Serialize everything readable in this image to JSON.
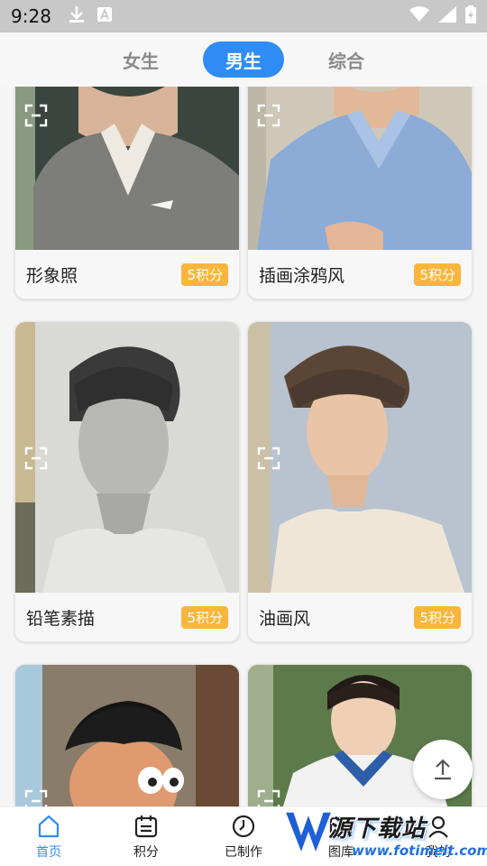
{
  "status_bar": {
    "time": "9:28"
  },
  "tabs": [
    {
      "label": "女生",
      "active": false
    },
    {
      "label": "男生",
      "active": true
    },
    {
      "label": "综合",
      "active": false
    }
  ],
  "cards": [
    {
      "title": "形象照",
      "points": "5积分"
    },
    {
      "title": "插画涂鸦风",
      "points": "5积分"
    },
    {
      "title": "铅笔素描",
      "points": "5积分"
    },
    {
      "title": "油画风",
      "points": "5积分"
    }
  ],
  "bottom_nav": [
    {
      "label": "首页",
      "icon": "home-icon",
      "active": true
    },
    {
      "label": "积分",
      "icon": "calendar-icon",
      "active": false
    },
    {
      "label": "已制作",
      "icon": "clock-icon",
      "active": false
    },
    {
      "label": "图库",
      "icon": "gallery-icon",
      "active": false
    },
    {
      "label": "我的",
      "icon": "user-icon",
      "active": false
    }
  ],
  "watermark": {
    "text": "源下载站",
    "url": "www.fotimeit.com"
  },
  "colors": {
    "accent": "#2f8cf5",
    "badge": "#f8b63c"
  }
}
